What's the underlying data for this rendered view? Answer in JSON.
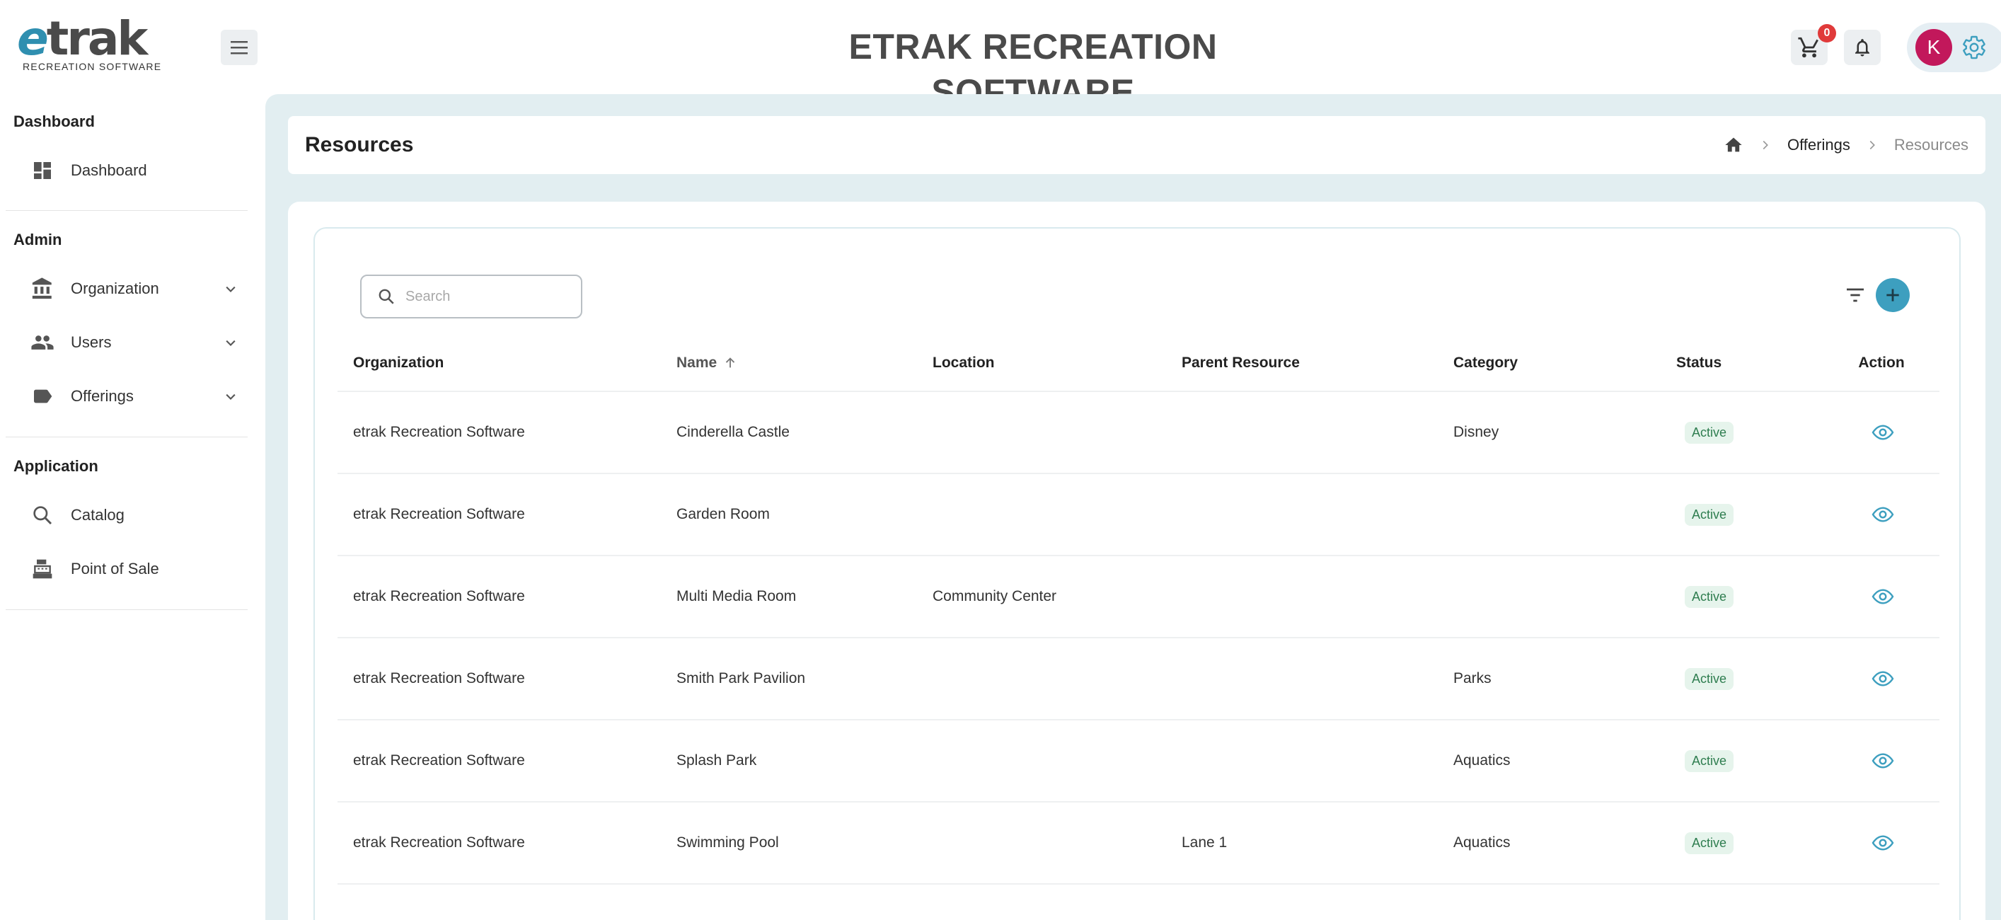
{
  "app": {
    "logo_text": "etrak",
    "logo_subtext": "RECREATION SOFTWARE",
    "title": "ETRAK RECREATION SOFTWARE",
    "cart_count": "0",
    "user_initial": "K"
  },
  "sidebar": {
    "sections": [
      {
        "heading": "Dashboard",
        "items": [
          {
            "label": "Dashboard",
            "icon": "dashboard-icon"
          }
        ]
      },
      {
        "heading": "Admin",
        "items": [
          {
            "label": "Organization",
            "icon": "bank-icon",
            "expandable": true
          },
          {
            "label": "Users",
            "icon": "users-icon",
            "expandable": true
          },
          {
            "label": "Offerings",
            "icon": "tag-icon",
            "expandable": true
          }
        ]
      },
      {
        "heading": "Application",
        "items": [
          {
            "label": "Catalog",
            "icon": "search-icon"
          },
          {
            "label": "Point of Sale",
            "icon": "cash-register-icon"
          }
        ]
      }
    ]
  },
  "page": {
    "title": "Resources",
    "breadcrumb": {
      "parent": "Offerings",
      "current": "Resources"
    }
  },
  "search": {
    "placeholder": "Search",
    "value": ""
  },
  "table": {
    "columns": [
      "Organization",
      "Name",
      "Location",
      "Parent Resource",
      "Category",
      "Status",
      "Action"
    ],
    "sorted_by": "Name",
    "sort_direction": "ascending",
    "rows": [
      {
        "organization": "etrak Recreation Software",
        "name": "Cinderella Castle",
        "location": "",
        "parent": "",
        "category": "Disney",
        "status": "Active"
      },
      {
        "organization": "etrak Recreation Software",
        "name": "Garden Room",
        "location": "",
        "parent": "",
        "category": "",
        "status": "Active"
      },
      {
        "organization": "etrak Recreation Software",
        "name": "Multi Media Room",
        "location": "Community Center",
        "parent": "",
        "category": "",
        "status": "Active"
      },
      {
        "organization": "etrak Recreation Software",
        "name": "Smith Park Pavilion",
        "location": "",
        "parent": "",
        "category": "Parks",
        "status": "Active"
      },
      {
        "organization": "etrak Recreation Software",
        "name": "Splash Park",
        "location": "",
        "parent": "",
        "category": "Aquatics",
        "status": "Active"
      },
      {
        "organization": "etrak Recreation Software",
        "name": "Swimming Pool",
        "location": "",
        "parent": "Lane 1",
        "category": "Aquatics",
        "status": "Active"
      }
    ]
  },
  "colors": {
    "accent": "#3d9fbf",
    "background": "#e2eef1",
    "avatar": "#c2185b",
    "badge_red": "#e03a3a",
    "status_active_bg": "#e6f4ec",
    "status_active_text": "#2e7d4f"
  }
}
